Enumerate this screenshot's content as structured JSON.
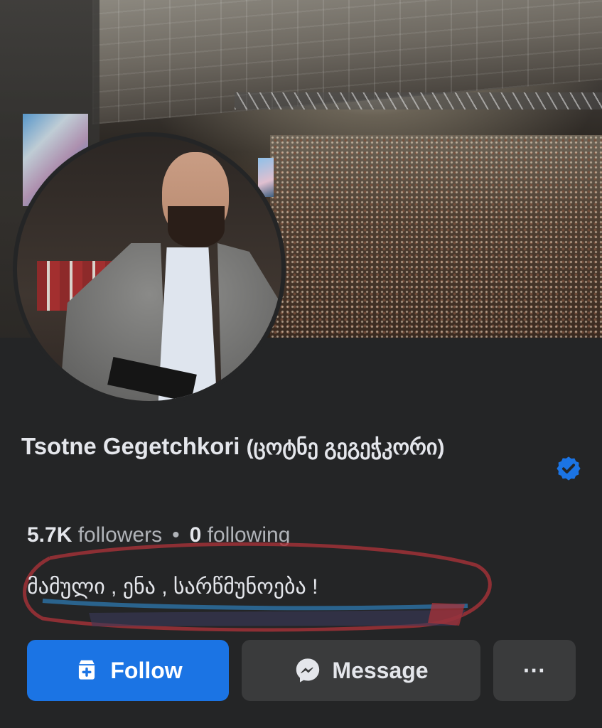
{
  "profile": {
    "name": "Tsotne Gegetchkori",
    "native_name": "(ცოტნე გეგეჭკორი)",
    "verified_icon": "verified-badge-icon",
    "followers_count": "5.7K",
    "followers_label": "followers",
    "separator": "•",
    "following_count": "0",
    "following_label": "following",
    "bio": "მამული , ენა , სარწმუნოება !"
  },
  "actions": {
    "follow_label": "Follow",
    "follow_icon": "follow-user-icon",
    "message_label": "Message",
    "message_icon": "messenger-icon",
    "more_label": "···",
    "more_icon": "more-options-icon"
  },
  "colors": {
    "background": "#242526",
    "primary_button": "#1b74e4",
    "secondary_button": "#3a3b3c",
    "verified_badge": "#1b74e4",
    "text_primary": "#e4e6eb",
    "text_secondary": "#b0b3b8",
    "annotation_red": "#a83238",
    "annotation_blue": "#2c6fa0"
  }
}
